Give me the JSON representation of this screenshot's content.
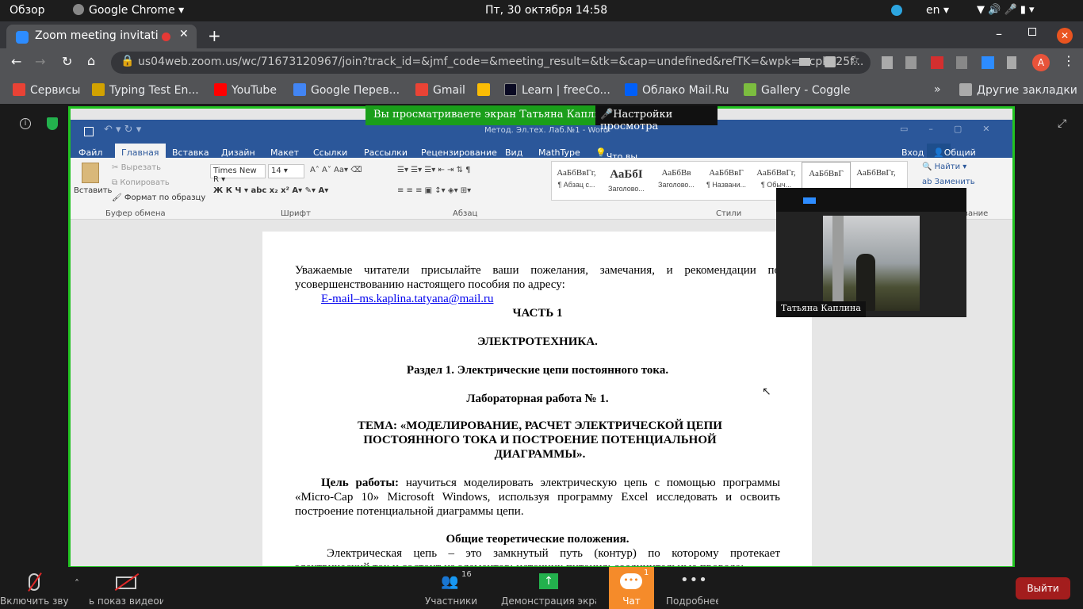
{
  "gnome": {
    "overview": "Обзор",
    "app": "Google Chrome",
    "clock": "Пт, 30 октября  14:58",
    "lang": "en"
  },
  "chrome": {
    "tab_title": "Zoom meeting invitati",
    "url": "us04web.zoom.us/wc/71673120967/join?track_id=&jmf_code=&meeting_result=&tk=&cap=undefined&refTK=&wpk=wcpkb25f...",
    "profile": "A",
    "bookmarks": [
      {
        "label": "Сервисы",
        "color": "#e94235"
      },
      {
        "label": "Typing Test En...",
        "color": "#d2a200"
      },
      {
        "label": "YouTube",
        "color": "#ff0000"
      },
      {
        "label": "Google Перев...",
        "color": "#4285f4"
      },
      {
        "label": "Gmail",
        "color": "#ea4335"
      },
      {
        "label": "",
        "color": "#fbbc04"
      },
      {
        "label": "Learn | freeCo...",
        "color": "#0a0a23"
      },
      {
        "label": "Облако Mail.Ru",
        "color": "#005ff9"
      },
      {
        "label": "Gallery - Coggle",
        "color": "#7cbd3f"
      }
    ],
    "other_bookmarks": "Другие закладки",
    "more": "»"
  },
  "zoom": {
    "banner_text": "Вы просматриваете экран Татьяна Каплина",
    "banner_settings": "Настройки просмотра",
    "participant_name": "Татьяна Каплина",
    "bar": {
      "mute": "Включить звук",
      "video": "ь показ видеоизоб",
      "participants": "Участники",
      "participants_count": "16",
      "share": "Демонстрация экрана",
      "chat": "Чат",
      "chat_badge": "1",
      "more": "Подробнее",
      "leave": "Выйти"
    }
  },
  "word": {
    "title": "Метод. Эл.тех. Лаб.№1 - Word",
    "tabs": [
      "Файл",
      "Главная",
      "Вставка",
      "Дизайн",
      "Макет",
      "Ссылки",
      "Рассылки",
      "Рецензирование",
      "Вид",
      "MathType"
    ],
    "tell_me": "Что вы хотите сделать?",
    "login": "Вход",
    "share": "Общий доступ",
    "clipboard": {
      "paste": "Вставить",
      "cut": "Вырезать",
      "copy": "Копировать",
      "format": "Формат по образцу",
      "group": "Буфер обмена"
    },
    "font": {
      "name": "Times New R",
      "size": "14",
      "group": "Шрифт"
    },
    "paragraph_group": "Абзац",
    "styles_group": "Стили",
    "edit_group": "Редактирование",
    "styles": [
      {
        "sample": "АаБбВвГг,",
        "name": "¶ Абзац с..."
      },
      {
        "sample": "АаБбI",
        "name": "Заголово..."
      },
      {
        "sample": "АаБбВв",
        "name": "Заголово..."
      },
      {
        "sample": "АаБбВвГ",
        "name": "¶ Названи..."
      },
      {
        "sample": "АаБбВвГг,",
        "name": "¶ Обыч..."
      },
      {
        "sample": "АаБбВвГ",
        "name": ""
      },
      {
        "sample": "АаБбВвГг,",
        "name": ""
      }
    ],
    "find": "Найти",
    "replace": "Заменить"
  },
  "doc": {
    "intro": "Уважаемые читатели присылайте ваши пожелания, замечания, и рекомендации по усовершенствованию настоящего пособия по адресу:",
    "email": "E-mail–ms.kaplina.tatyana@mail.ru",
    "part": "ЧАСТЬ 1",
    "subject": "ЭЛЕКТРОТЕХНИКА.",
    "section": "Раздел 1. Электрические цепи постоянного тока.",
    "lab": "Лабораторная работа № 1.",
    "topic": "ТЕМА: «МОДЕЛИРОВАНИЕ, РАСЧЕТ ЭЛЕКТРИЧЕСКОЙ ЦЕПИ ПОСТОЯННОГО ТОКА И ПОСТРОЕНИЕ ПОТЕНЦИАЛЬНОЙ ДИАГРАММЫ».",
    "goal_label": "Цель работы:",
    "goal_text": " научиться моделировать электрическую цепь с помощью программы «Micro-Cap 10» Microsoft Windows, используя программу Excel исследовать и освоить построение потенциальной диаграммы цепи.",
    "theory": "Общие теоретические положения.",
    "theory_text": "Электрическая цепь – это замкнутый путь (контур) по которому протекает электрический ток и состоит из элементов: источник питания; соединительные провода;"
  }
}
